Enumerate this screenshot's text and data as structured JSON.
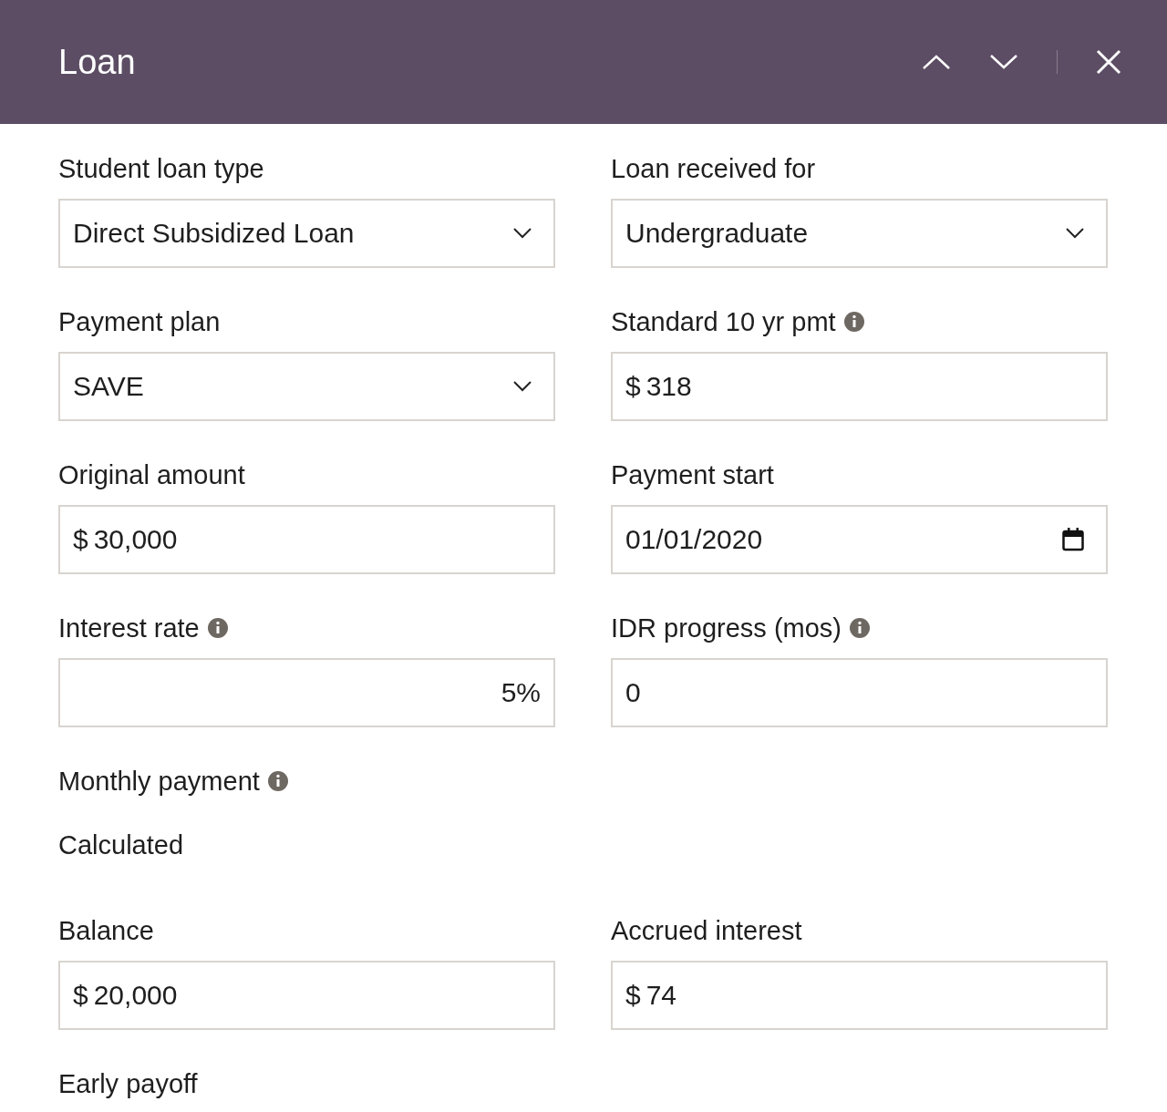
{
  "header": {
    "title": "Loan"
  },
  "rows": [
    {
      "fields": [
        {
          "label": "Student loan type",
          "info": false,
          "kind": "select",
          "value": "Direct Subsidized Loan"
        },
        {
          "label": "Loan received for",
          "info": false,
          "kind": "select",
          "value": "Undergraduate"
        }
      ]
    },
    {
      "fields": [
        {
          "label": "Payment plan",
          "info": false,
          "kind": "select",
          "value": "SAVE"
        },
        {
          "label": "Standard 10 yr pmt",
          "info": true,
          "kind": "money",
          "value": "318"
        }
      ]
    },
    {
      "fields": [
        {
          "label": "Original amount",
          "info": false,
          "kind": "money",
          "value": "30,000"
        },
        {
          "label": "Payment start",
          "info": false,
          "kind": "date",
          "value": "01/01/2020"
        }
      ]
    },
    {
      "fields": [
        {
          "label": "Interest rate",
          "info": true,
          "kind": "percent",
          "value": "5%"
        },
        {
          "label": "IDR progress (mos)",
          "info": true,
          "kind": "text",
          "value": "0"
        }
      ]
    },
    {
      "fields": [
        {
          "label": "Monthly payment",
          "info": true,
          "kind": "static",
          "value": "Calculated"
        }
      ]
    },
    {
      "fields": [
        {
          "label": "Balance",
          "info": false,
          "kind": "money",
          "value": "20,000"
        },
        {
          "label": "Accrued interest",
          "info": false,
          "kind": "money",
          "value": "74"
        }
      ]
    },
    {
      "fields": [
        {
          "label": "Early payoff",
          "info": false,
          "kind": "text"
        }
      ]
    }
  ],
  "currency": "$"
}
